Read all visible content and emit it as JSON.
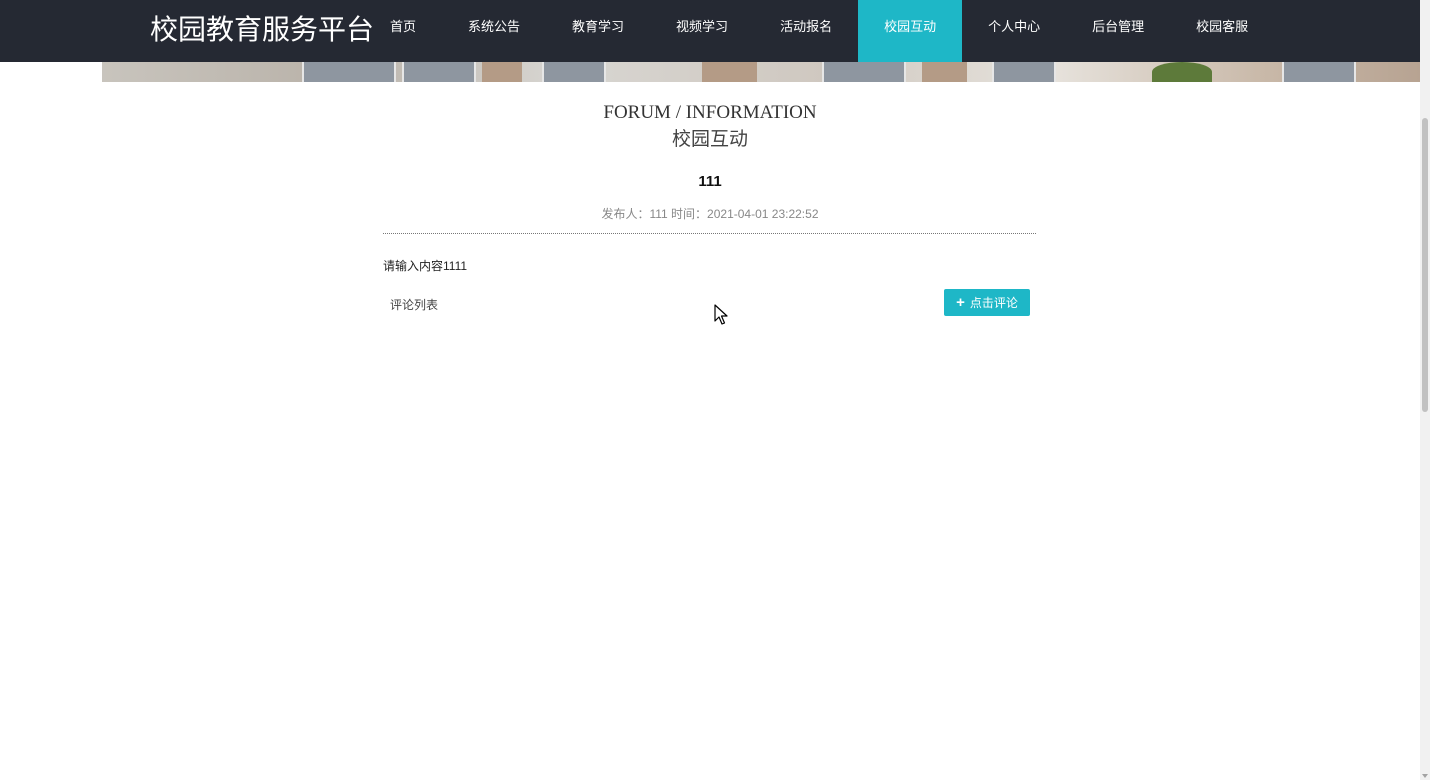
{
  "header": {
    "brand": "校园教育服务平台",
    "nav": [
      {
        "label": "首页",
        "active": false
      },
      {
        "label": "系统公告",
        "active": false
      },
      {
        "label": "教育学习",
        "active": false
      },
      {
        "label": "视频学习",
        "active": false
      },
      {
        "label": "活动报名",
        "active": false
      },
      {
        "label": "校园互动",
        "active": true
      },
      {
        "label": "个人中心",
        "active": false
      },
      {
        "label": "后台管理",
        "active": false
      },
      {
        "label": "校园客服",
        "active": false
      }
    ]
  },
  "section": {
    "title_en": "FORUM / INFORMATION",
    "title_zh": "校园互动"
  },
  "post": {
    "title": "111",
    "meta": "发布人：111 时间：2021-04-01 23:22:52",
    "content": "请输入内容1111"
  },
  "comments": {
    "title": "评论列表",
    "add_button_label": "点击评论",
    "add_button_icon": "plus-icon"
  },
  "colors": {
    "navbar": "#252933",
    "accent": "#1eb7c7"
  }
}
